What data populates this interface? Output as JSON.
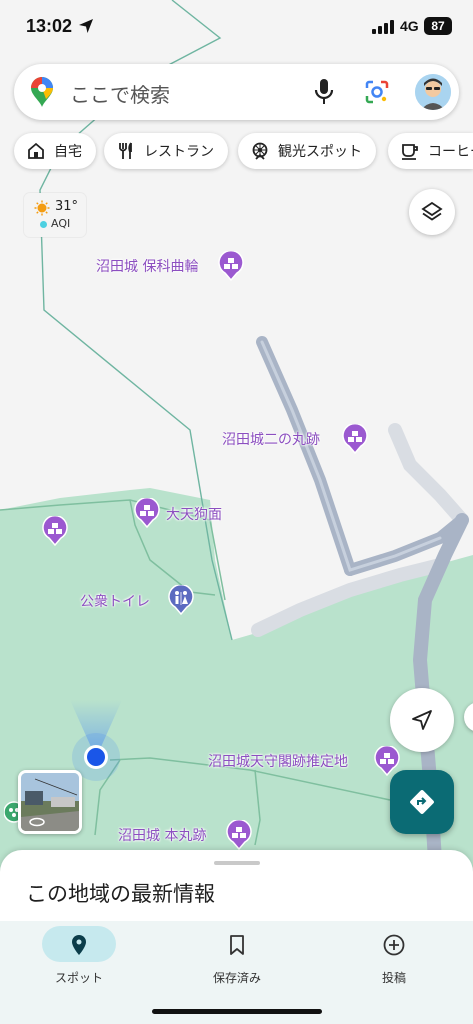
{
  "status_bar": {
    "time": "13:02",
    "network": "4G",
    "battery": "87"
  },
  "search": {
    "placeholder": "ここで検索",
    "icons": [
      "maps-pin-icon",
      "mic-icon",
      "lens-icon",
      "avatar"
    ]
  },
  "chips": [
    {
      "label": "自宅",
      "icon": "home-icon"
    },
    {
      "label": "レストラン",
      "icon": "restaurant-icon"
    },
    {
      "label": "観光スポット",
      "icon": "attraction-icon"
    },
    {
      "label": "コーヒー",
      "icon": "coffee-icon"
    }
  ],
  "weather": {
    "temp": "31°",
    "aqi": "AQI"
  },
  "pois": [
    {
      "label": "沼田城 保科曲輪"
    },
    {
      "label": "沼田城二の丸跡"
    },
    {
      "label": "大天狗面"
    },
    {
      "label": "公衆トイレ"
    },
    {
      "label": "沼田城天守閣跡推定地"
    },
    {
      "label": "沼田城 本丸跡"
    }
  ],
  "sheet": {
    "title": "この地域の最新情報"
  },
  "bottom_nav": [
    {
      "label": "スポット",
      "icon": "location-pin-icon",
      "active": true
    },
    {
      "label": "保存済み",
      "icon": "bookmark-icon",
      "active": false
    },
    {
      "label": "投稿",
      "icon": "add-circle-icon",
      "active": false
    }
  ],
  "colors": {
    "park": "#b9e2cc",
    "road": "#a9b4c6",
    "poi": "#8c4fc0",
    "accent": "#0b6b74",
    "location": "#1a56e8"
  }
}
